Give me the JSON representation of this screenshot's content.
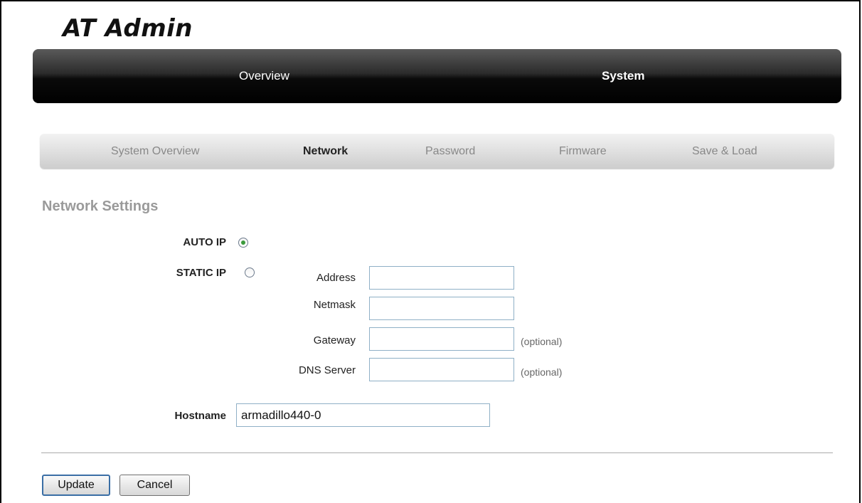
{
  "app": {
    "logo": "AT Admin"
  },
  "main_nav": {
    "items": [
      {
        "label": "Overview"
      },
      {
        "label": "System"
      }
    ],
    "active": "System"
  },
  "sub_nav": {
    "tabs": [
      {
        "label": "System Overview"
      },
      {
        "label": "Network"
      },
      {
        "label": "Password"
      },
      {
        "label": "Firmware"
      },
      {
        "label": "Save & Load"
      }
    ],
    "active": "Network"
  },
  "network": {
    "title": "Network Settings",
    "auto_ip": {
      "label": "AUTO IP",
      "selected": true
    },
    "static_ip": {
      "label": "STATIC IP",
      "selected": false
    },
    "address": {
      "label": "Address",
      "value": ""
    },
    "netmask": {
      "label": "Netmask",
      "value": ""
    },
    "gateway": {
      "label": "Gateway",
      "value": "",
      "hint": "(optional)"
    },
    "dns": {
      "label": "DNS Server",
      "value": "",
      "hint": "(optional)"
    },
    "hostname": {
      "label": "Hostname",
      "value": "armadillo440-0"
    }
  },
  "actions": {
    "update_label": "Update",
    "cancel_label": "Cancel"
  },
  "colors": {
    "radio_selected": "#3c9a3c",
    "field_border": "#8fb0c6",
    "primary_button_border": "#3a6ea5"
  }
}
